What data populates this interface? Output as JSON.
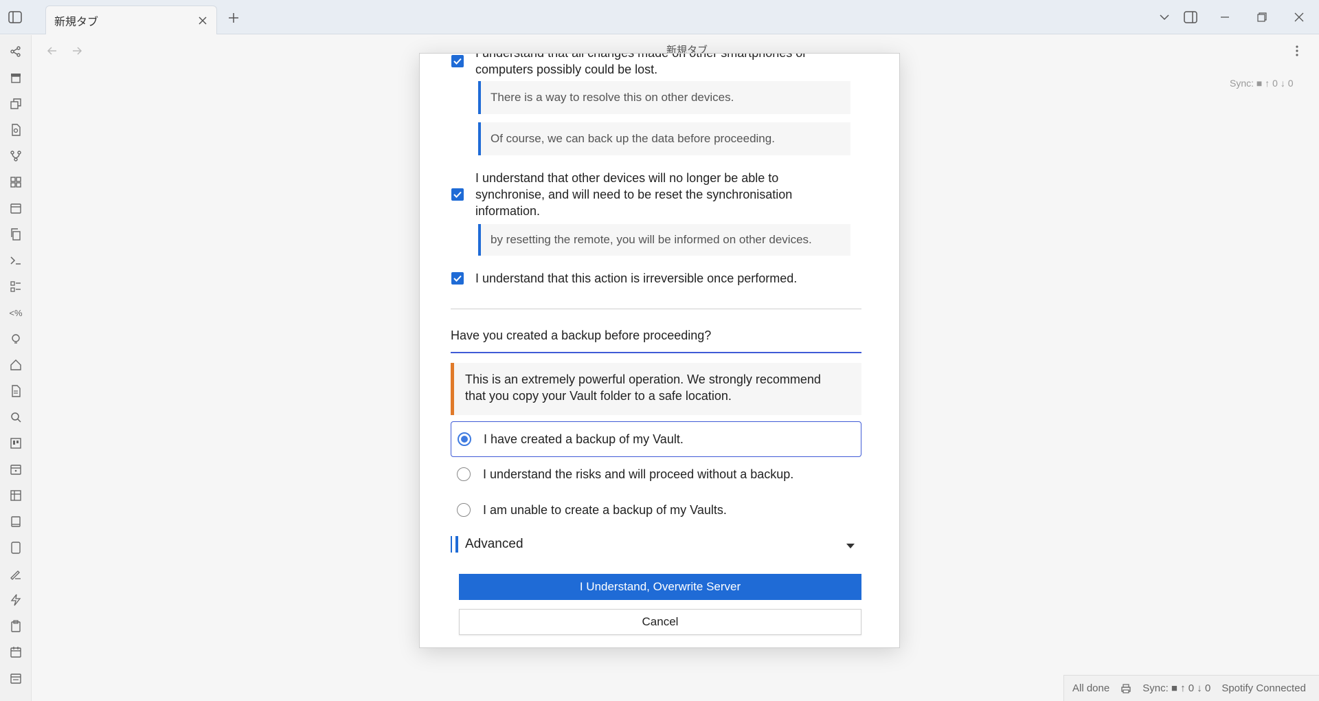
{
  "titlebar": {
    "tab_title": "新規タブ",
    "icons": [
      "sidebar-toggle-icon",
      "close-icon",
      "plus-icon",
      "chevron-down-icon",
      "split-panel-icon",
      "minimize-icon",
      "restore-icon",
      "close-window-icon"
    ]
  },
  "view": {
    "title": "新規タブ",
    "sync_status": "Sync: ■ ↑ 0 ↓ 0"
  },
  "ribbon": {
    "icons": [
      "graph-icon",
      "archive-icon",
      "layers-icon",
      "file-search-icon",
      "git-branch-icon",
      "grid-icon",
      "calendar-icon",
      "copy-icon",
      "terminal-icon",
      "checklist-icon",
      "template-icon",
      "lightbulb-icon",
      "home-icon",
      "document-icon",
      "search-icon",
      "kanban-icon",
      "calendar-days-icon",
      "table-icon",
      "book-icon",
      "tablet-icon",
      "signature-icon",
      "lightning-icon",
      "clipboard-icon",
      "calendar-alt-icon",
      "calendar-week-icon"
    ]
  },
  "modal": {
    "ack1": {
      "line1": "I understand that all changes made on other smartphones or",
      "line2": "computers possibly could be lost."
    },
    "note1": "There is a way to resolve this on other devices.",
    "note2": "Of course, we can back up the data before proceeding.",
    "ack2": {
      "line1": "I understand that other devices will no longer be able to",
      "line2": "synchronise, and will need to be reset the synchronisation",
      "line3": "information."
    },
    "note3": "by resetting the remote, you will be informed on other devices.",
    "ack3": "I understand that this action is irreversible once performed.",
    "question": "Have you created a backup before proceeding?",
    "warning": {
      "line1": "This is an extremely powerful operation. We strongly recommend",
      "line2": "that you copy your Vault folder to a safe location."
    },
    "options": [
      {
        "label": "I have created a backup of my Vault.",
        "selected": true
      },
      {
        "label": "I understand the risks and will proceed without a backup.",
        "selected": false
      },
      {
        "label": "I am unable to create a backup of my Vaults.",
        "selected": false
      }
    ],
    "advanced_label": "Advanced",
    "confirm_button": "I Understand, Overwrite Server",
    "cancel_button": "Cancel",
    "accent_color": "#1f6bd6",
    "warning_color": "#e07a2a"
  },
  "statusbar": {
    "all_done": "All done",
    "sync": "Sync: ■ ↑ 0 ↓ 0",
    "spotify": "Spotify Connected"
  }
}
